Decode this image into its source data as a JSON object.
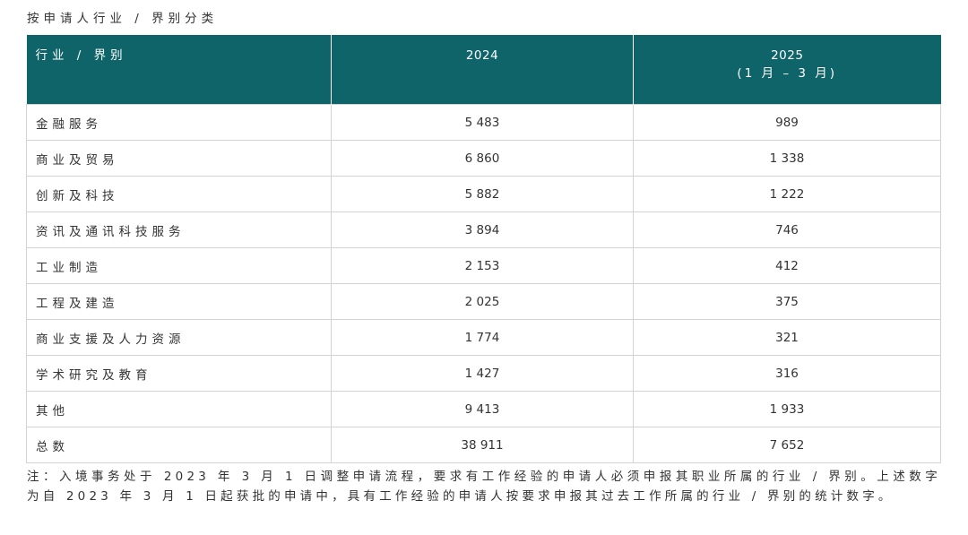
{
  "caption": "按申请人行业 / 界别分类",
  "table": {
    "headers": {
      "category": "行业 / 界别",
      "year1": "2024",
      "year2": "2025",
      "year2_sub": "(1 月 – 3 月)"
    },
    "rows": [
      {
        "label": "金融服务",
        "v2024": "5 483",
        "v2025": "989"
      },
      {
        "label": "商业及贸易",
        "v2024": "6 860",
        "v2025": "1 338"
      },
      {
        "label": "创新及科技",
        "v2024": "5 882",
        "v2025": "1 222"
      },
      {
        "label": "资讯及通讯科技服务",
        "v2024": "3 894",
        "v2025": "746"
      },
      {
        "label": "工业制造",
        "v2024": "2 153",
        "v2025": "412"
      },
      {
        "label": "工程及建造",
        "v2024": "2 025",
        "v2025": "375"
      },
      {
        "label": "商业支援及人力资源",
        "v2024": "1 774",
        "v2025": "321"
      },
      {
        "label": "学术研究及教育",
        "v2024": "1 427",
        "v2025": "316"
      },
      {
        "label": "其他",
        "v2024": "9 413",
        "v2025": "1 933"
      },
      {
        "label": "总数",
        "v2024": "38 911",
        "v2025": "7 652"
      }
    ]
  },
  "note": "注：入境事务处于 2023 年 3 月 1 日调整申请流程，要求有工作经验的申请人必须申报其职业所属的行业 / 界别。上述数字为自 2023 年 3 月 1 日起获批的申请中，具有工作经验的申请人按要求申报其过去工作所属的行业 / 界别的统计数字。",
  "colors": {
    "header_bg": "#0e6469",
    "border": "#d3d3d3",
    "text": "#333333"
  }
}
